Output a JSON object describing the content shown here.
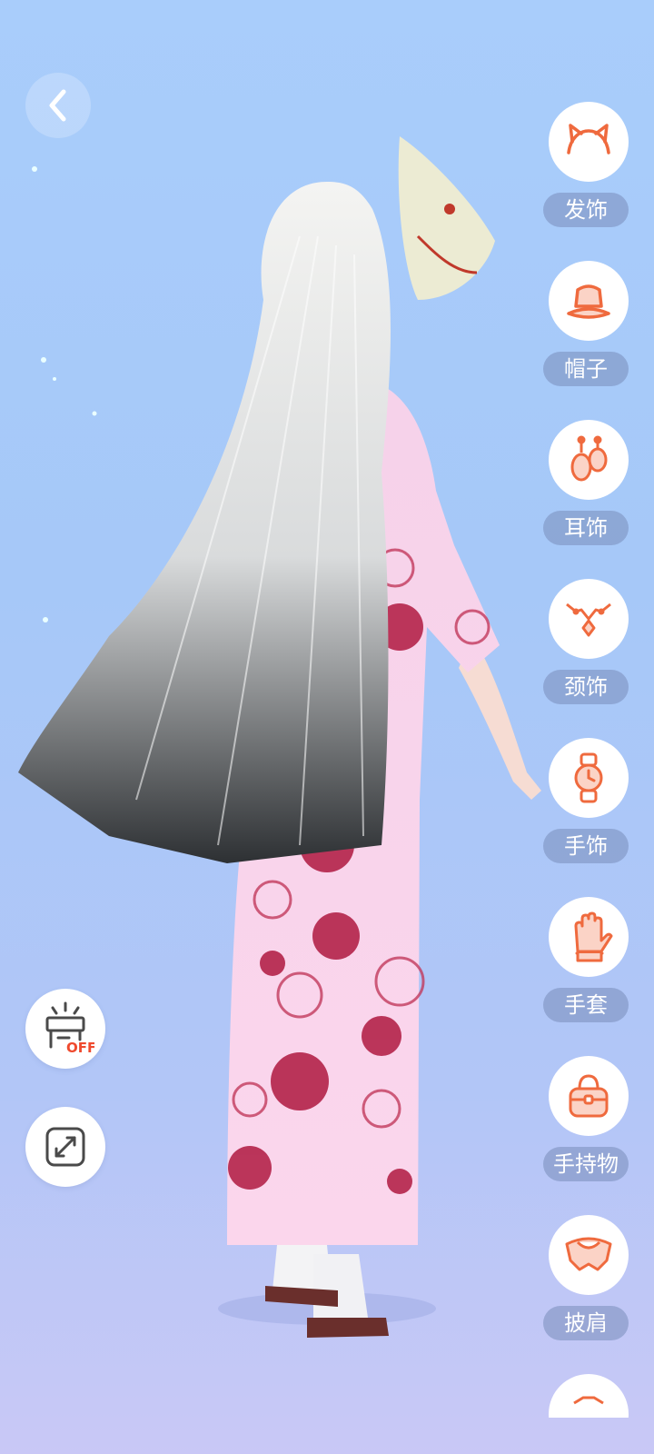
{
  "colors": {
    "accent": "#ef6a3e",
    "label_bg": "#8c9cc6",
    "sky": "#a9cdfb"
  },
  "nav": {
    "back_icon": "chevron-left-icon"
  },
  "tools": {
    "stage_icon": "stage-off-icon",
    "stage_badge": "OFF",
    "fullscreen_icon": "expand-icon"
  },
  "categories": [
    {
      "label": "发饰",
      "icon": "cat-ear-headband-icon"
    },
    {
      "label": "帽子",
      "icon": "bucket-hat-icon"
    },
    {
      "label": "耳饰",
      "icon": "earring-icon"
    },
    {
      "label": "颈饰",
      "icon": "necklace-icon"
    },
    {
      "label": "手饰",
      "icon": "wristwatch-icon"
    },
    {
      "label": "手套",
      "icon": "glove-icon"
    },
    {
      "label": "手持物",
      "icon": "handbag-icon"
    },
    {
      "label": "披肩",
      "icon": "shawl-icon"
    }
  ]
}
